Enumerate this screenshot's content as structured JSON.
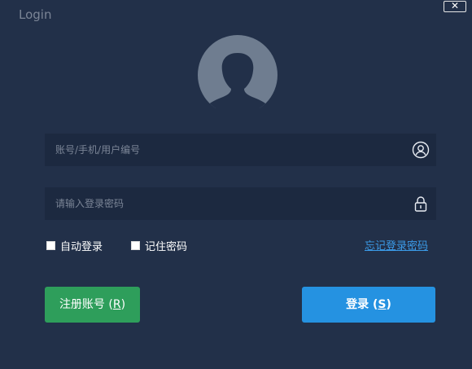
{
  "window": {
    "title": "Login",
    "close_label": "✕"
  },
  "avatar": {
    "icon": "default-user-avatar"
  },
  "fields": {
    "account": {
      "placeholder": "账号/手机/用户编号",
      "value": "",
      "icon": "user-circle-icon"
    },
    "password": {
      "placeholder": "请输入登录密码",
      "value": "",
      "icon": "lock-icon"
    }
  },
  "options": {
    "auto_login": {
      "label": "自动登录",
      "checked": false
    },
    "remember_password": {
      "label": "记住密码",
      "checked": false
    },
    "forgot_password": "忘记登录密码"
  },
  "buttons": {
    "register": {
      "text": "注册账号 (",
      "key": "R",
      "close": ")"
    },
    "login": {
      "text": "登录 (",
      "key": "S",
      "close": ")"
    }
  },
  "colors": {
    "background": "#223049",
    "field": "#1c2940",
    "register": "#2e9e5b",
    "login": "#2592e1",
    "link": "#3b9be8"
  }
}
